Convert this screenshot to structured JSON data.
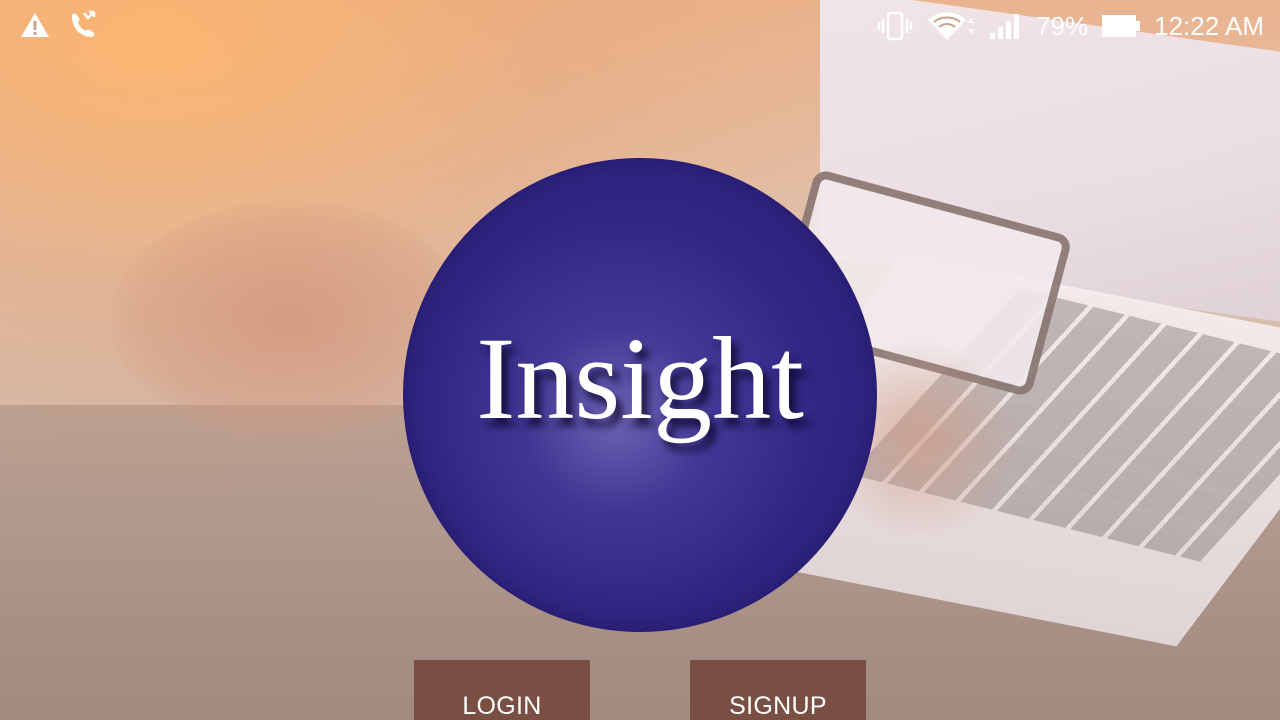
{
  "status_bar": {
    "battery_percent": "79%",
    "time": "12:22 AM",
    "icons": [
      "warning-icon",
      "missed-call-icon",
      "vibrate-icon",
      "wifi-icon",
      "signal-icon",
      "battery-icon"
    ]
  },
  "logo": {
    "text": "Insight"
  },
  "buttons": {
    "login_label": "LOGIN",
    "signup_label": "SIGNUP"
  },
  "colors": {
    "logo_circle": "#2f2582",
    "button_bg": "#7a4f43",
    "text": "#ffffff"
  }
}
